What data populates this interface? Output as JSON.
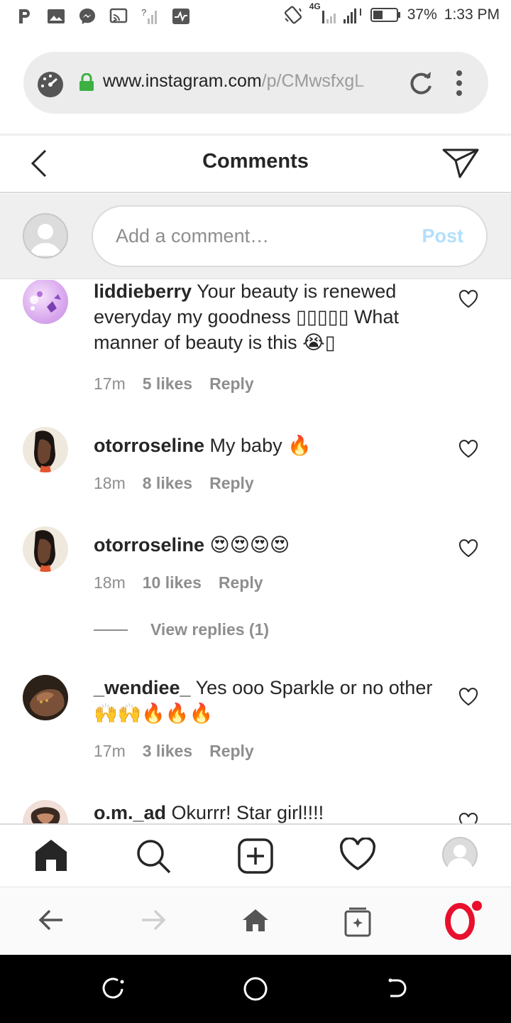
{
  "status_bar": {
    "network": "4G",
    "battery": "37%",
    "time": "1:33 PM",
    "notification_icons": [
      "p-icon",
      "photo-icon",
      "messenger-icon",
      "cast-icon",
      "no-signal-icon",
      "activity-icon"
    ]
  },
  "browser": {
    "url_main": "www.instagram.com",
    "url_dim": "/p/CMwsfxgL",
    "tabs_icon": "tabs-icon",
    "accent": "#e8102d"
  },
  "header": {
    "title": "Comments"
  },
  "composer": {
    "placeholder": "Add a comment…",
    "post_label": "Post",
    "post_color": "#b2dffc"
  },
  "comments": [
    {
      "username": "liddieberry",
      "text": "Your beauty is renewed everyday my goodness ▯▯▯▯▯ What manner of beauty is this",
      "emoji_tail": "😭▯",
      "time": "17m",
      "likes": "5 likes",
      "reply": "Reply"
    },
    {
      "username": "otorroseline",
      "text": "My baby",
      "emoji_tail": "🔥",
      "time": "18m",
      "likes": "8 likes",
      "reply": "Reply"
    },
    {
      "username": "otorroseline",
      "text": "",
      "emoji_tail": "😍😍😍😍",
      "time": "18m",
      "likes": "10 likes",
      "reply": "Reply",
      "view_replies": "View replies (1)"
    },
    {
      "username": "_wendiee_",
      "text": "Yes ooo Sparkle or no other",
      "emoji_tail": "🙌🙌🔥🔥🔥",
      "time": "17m",
      "likes": "3 likes",
      "reply": "Reply"
    },
    {
      "username": "o.m._ad",
      "text": "Okurrr! Star girl!!!!",
      "emoji_tail": "",
      "time": "",
      "likes": "",
      "reply": ""
    }
  ]
}
